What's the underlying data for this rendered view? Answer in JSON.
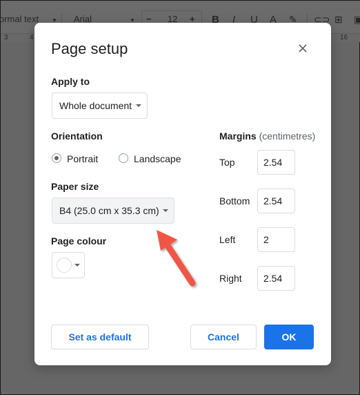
{
  "background": {
    "toolbar": {
      "style_select": "ormal text",
      "font_select": "Arial",
      "font_size": "12",
      "decrease_label": "−",
      "increase_label": "+",
      "bold": "B",
      "italic": "I",
      "underline": "U",
      "text_color": "A"
    },
    "ruler": {
      "left_marks": [
        "3",
        "4"
      ],
      "right_marks": [
        "16"
      ]
    }
  },
  "dialog": {
    "title": "Page setup",
    "apply_to": {
      "label": "Apply to",
      "value": "Whole document"
    },
    "orientation": {
      "label": "Orientation",
      "options": [
        {
          "label": "Portrait",
          "checked": true
        },
        {
          "label": "Landscape",
          "checked": false
        }
      ]
    },
    "paper_size": {
      "label": "Paper size",
      "value": "B4 (25.0 cm x 35.3 cm)"
    },
    "page_colour": {
      "label": "Page colour",
      "value": "#ffffff"
    },
    "margins": {
      "label": "Margins",
      "unit": "(centimetres)",
      "fields": [
        {
          "label": "Top",
          "value": "2.54"
        },
        {
          "label": "Bottom",
          "value": "2.54"
        },
        {
          "label": "Left",
          "value": "2"
        },
        {
          "label": "Right",
          "value": "2.54"
        }
      ]
    },
    "buttons": {
      "set_default": "Set as default",
      "cancel": "Cancel",
      "ok": "OK"
    }
  },
  "annotation": {
    "arrow_color": "#f05545"
  },
  "colors": {
    "accent": "#1a73e8"
  }
}
